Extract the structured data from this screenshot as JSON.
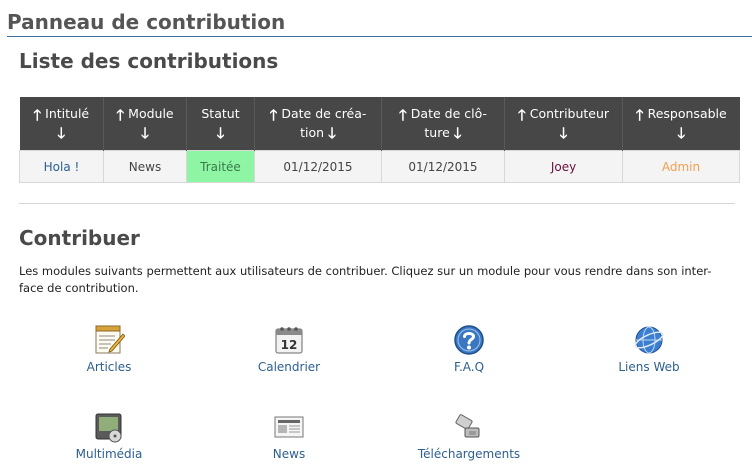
{
  "page": {
    "title": "Panneau de contribution"
  },
  "list_section": {
    "title": "Liste des contributions",
    "headers": [
      {
        "line1": "Intitulé",
        "line2": ""
      },
      {
        "line1": "Module",
        "line2": ""
      },
      {
        "line1": "Statut",
        "line2": ""
      },
      {
        "line1": "Date de créa-",
        "line2": "tion"
      },
      {
        "line1": "Date de clô-",
        "line2": "ture"
      },
      {
        "line1": "Contributeur",
        "line2": ""
      },
      {
        "line1": "Responsable",
        "line2": ""
      }
    ],
    "row": {
      "title": "Hola !",
      "module": "News",
      "status": "Traitée",
      "created": "01/12/2015",
      "closed": "01/12/2015",
      "contributor": "Joey",
      "responsible": "Admin"
    }
  },
  "contribute_section": {
    "title": "Contribuer",
    "intro_line1": "Les modules suivants permettent aux utilisateurs de contribuer. Cliquez sur un module pour vous rendre dans son inter-",
    "intro_line2": "face de contribution.",
    "modules": [
      {
        "label": "Articles",
        "icon": "articles-icon"
      },
      {
        "label": "Calendrier",
        "icon": "calendar-icon"
      },
      {
        "label": "F.A.Q",
        "icon": "faq-icon"
      },
      {
        "label": "Liens Web",
        "icon": "web-links-icon"
      },
      {
        "label": "Multimédia",
        "icon": "multimedia-icon"
      },
      {
        "label": "News",
        "icon": "news-icon"
      },
      {
        "label": "Téléchargements",
        "icon": "downloads-icon"
      }
    ],
    "calendar_day": "12"
  },
  "colors": {
    "header_bg": "#474747",
    "status_bg": "#8ef5a4",
    "link": "#2a5f95",
    "contributor": "#6a1040",
    "responsible": "#f0a050"
  }
}
